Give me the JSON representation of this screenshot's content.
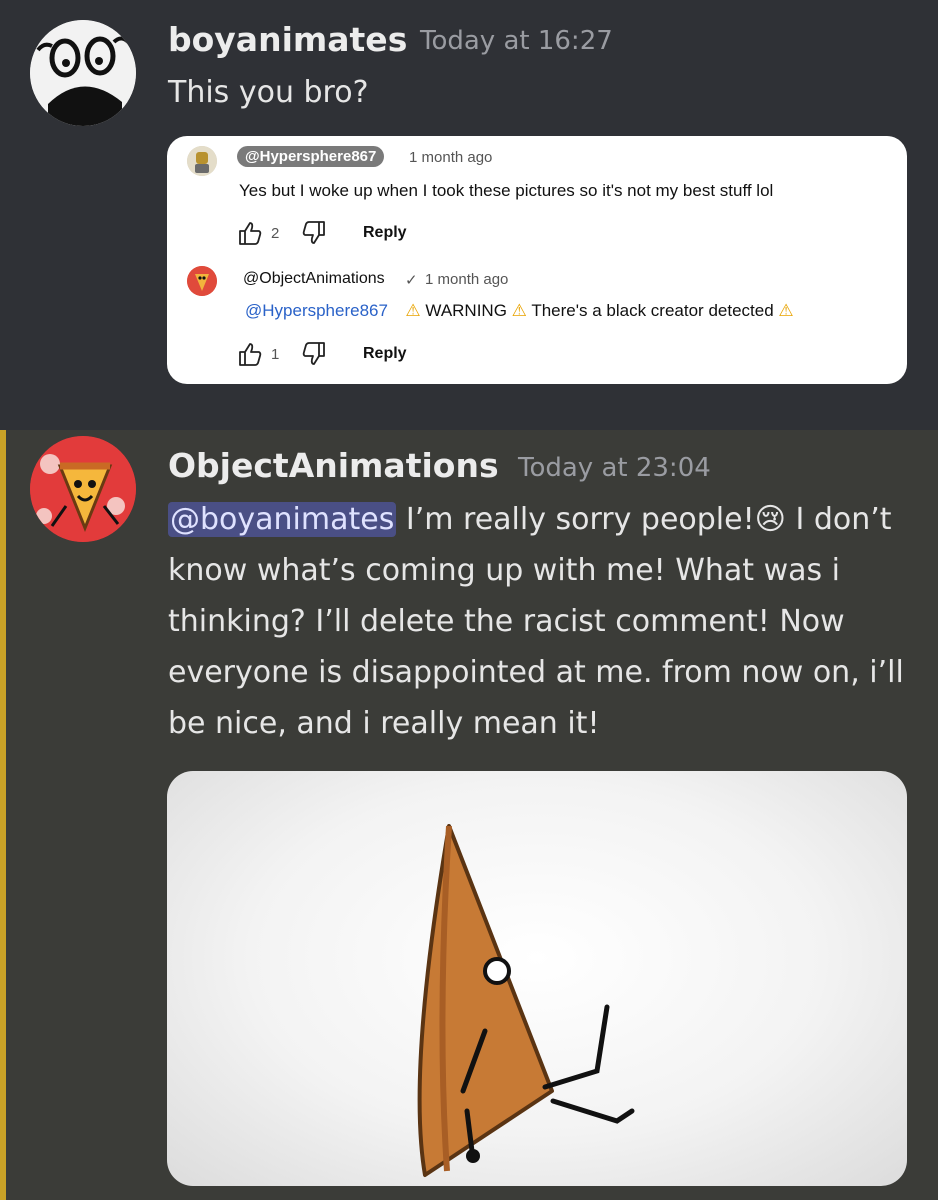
{
  "message1": {
    "username": "boyanimates",
    "timestamp": "Today at 16:27",
    "text": "This you bro?"
  },
  "embed": {
    "comment1": {
      "handle": "@Hypersphere867",
      "age": "1 month ago",
      "text": "Yes but I woke up when I took these pictures so it's not my best stuff lol",
      "likes": "2",
      "reply_label": "Reply"
    },
    "comment2": {
      "handle": "@ObjectAnimations",
      "verified": "✓",
      "age": "1 month ago",
      "mention": "@Hypersphere867",
      "text_a": "WARNING",
      "text_b": "There's a black creator detected",
      "likes": "1",
      "reply_label": "Reply"
    }
  },
  "message2": {
    "username": "ObjectAnimations",
    "timestamp": "Today at 23:04",
    "mention": "@boyanimates",
    "text_a": " I’m really sorry people!",
    "emoji": "😢",
    "text_b": " I don’t know what’s coming up with me! What was i thinking? I’ll delete the racist comment! Now everyone is disappointed at me. from now on, i’ll be nice, and i really mean it!"
  },
  "icons": {
    "warning": "warning-icon",
    "like": "thumbs-up-icon",
    "dislike": "thumbs-down-icon"
  },
  "colors": {
    "background_top": "#2f3136",
    "background_bottom": "#3b3c38",
    "highlight_bar": "#c9a227",
    "mention_bg": "#4a4f85",
    "link": "#2a62c8"
  }
}
